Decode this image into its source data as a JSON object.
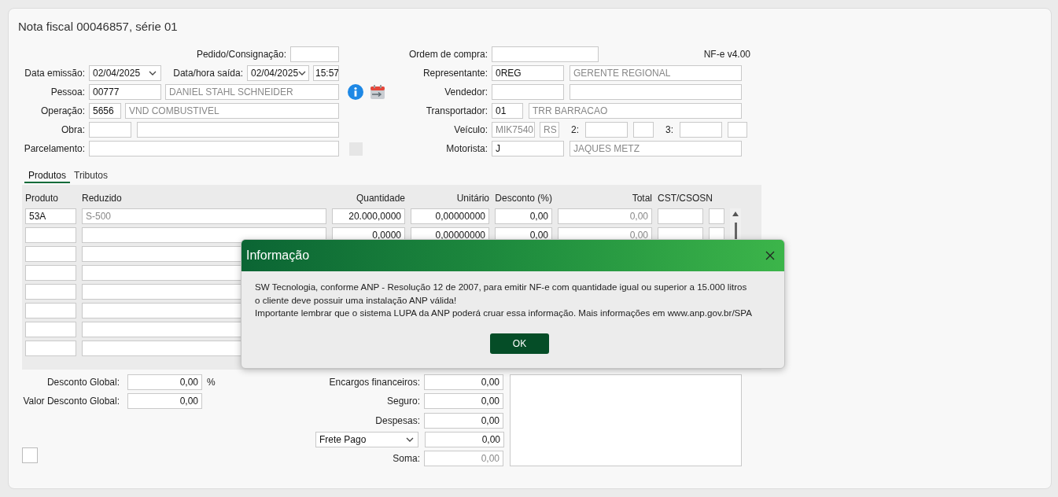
{
  "title": "Nota fiscal 00046857, série 01",
  "version": "NF-e v4.00",
  "header_left": {
    "pedido_consignacao": {
      "label": "Pedido/Consignação:"
    },
    "data_emissao": {
      "label": "Data emissão:",
      "value": "02/04/2025"
    },
    "data_hora_saida": {
      "label": "Data/hora saída:",
      "date": "02/04/2025",
      "time": "15:57"
    },
    "pessoa": {
      "label": "Pessoa:",
      "code": "00777",
      "name": "DANIEL STAHL SCHNEIDER"
    },
    "operacao": {
      "label": "Operação:",
      "code": "5656",
      "name": "VND COMBUSTIVEL"
    },
    "obra": {
      "label": "Obra:"
    },
    "parcelamento": {
      "label": "Parcelamento:"
    }
  },
  "header_right": {
    "ordem_compra": {
      "label": "Ordem de compra:"
    },
    "representante": {
      "label": "Representante:",
      "code": "0REG",
      "name": "GERENTE REGIONAL"
    },
    "vendedor": {
      "label": "Vendedor:"
    },
    "transportador": {
      "label": "Transportador:",
      "code": "01",
      "name": "TRR BARRACAO"
    },
    "veiculo": {
      "label": "Veículo:",
      "plate": "MIK7540",
      "state": "RS",
      "label_2": "2:",
      "label_3": "3:"
    },
    "motorista": {
      "label": "Motorista:",
      "code": "J",
      "name": "JAQUES METZ"
    }
  },
  "tabs": [
    {
      "label": "Produtos",
      "selected": true
    },
    {
      "label": "Tributos",
      "selected": false
    }
  ],
  "items_table": {
    "columns": [
      "Produto",
      "Reduzido",
      "Quantidade",
      "Unitário",
      "Desconto (%)",
      "Total",
      "CST/CSOSN"
    ],
    "rows": [
      {
        "produto": "53A",
        "reduzido": "S-500",
        "quantidade": "20.000,0000",
        "unitario": "0,00000000",
        "desconto": "0,00",
        "total": "0,00"
      },
      {
        "quantidade": "0,0000",
        "unitario": "0,00000000",
        "desconto": "0,00",
        "total": "0,00"
      }
    ]
  },
  "totals": {
    "desconto_global": {
      "label": "Desconto Global:",
      "value": "0,00",
      "unit": "%"
    },
    "valor_desconto_global": {
      "label": "Valor Desconto Global:",
      "value": "0,00"
    },
    "encargos": {
      "label": "Encargos financeiros:",
      "value": "0,00"
    },
    "seguro": {
      "label": "Seguro:",
      "value": "0,00"
    },
    "despesas": {
      "label": "Despesas:",
      "value": "0,00"
    },
    "frete": {
      "option": "Frete Pago",
      "value": "0,00"
    },
    "soma": {
      "label": "Soma:",
      "value": "0,00"
    },
    "checkbox": {
      "checked": false
    }
  },
  "dialog": {
    "title": "Informação",
    "message_lines": [
      "SW Tecnologia, conforme ANP - Resolução 12 de 2007, para emitir NF-e com quantidade igual ou superior a 15.000 litros",
      "o cliente deve possuir uma instalação ANP válida!",
      "Importante lembrar que o sistema LUPA da ANP poderá cruar essa informação. Mais informações em www.anp.gov.br/SPA"
    ],
    "button": "OK"
  }
}
